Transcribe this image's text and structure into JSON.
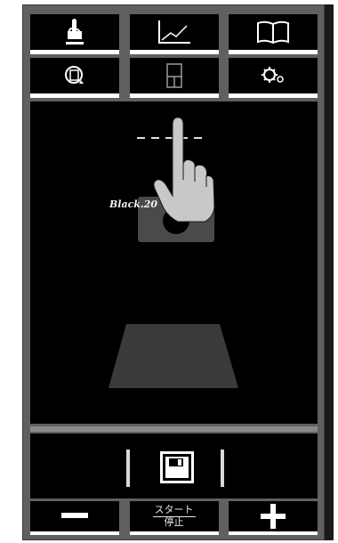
{
  "nav": {
    "row1": [
      {
        "icon": "touch-hand-icon"
      },
      {
        "icon": "line-chart-icon"
      },
      {
        "icon": "open-book-icon"
      }
    ],
    "row2": [
      {
        "icon": "rotate-screen-icon"
      },
      {
        "icon": "layout-panel-icon"
      },
      {
        "icon": "gears-icon"
      }
    ]
  },
  "viewport": {
    "model_label": "Black.20",
    "colors": {
      "background": "#000000",
      "hand": "#c8c8c8",
      "block": "#4a4a4a",
      "pad": "#3a3a3a"
    }
  },
  "savebar": {
    "icon": "floppy-disk-icon"
  },
  "bottom": {
    "minus_icon": "minus-icon",
    "start_label": "スタート",
    "stop_label": "停止",
    "plus_icon": "plus-icon"
  }
}
